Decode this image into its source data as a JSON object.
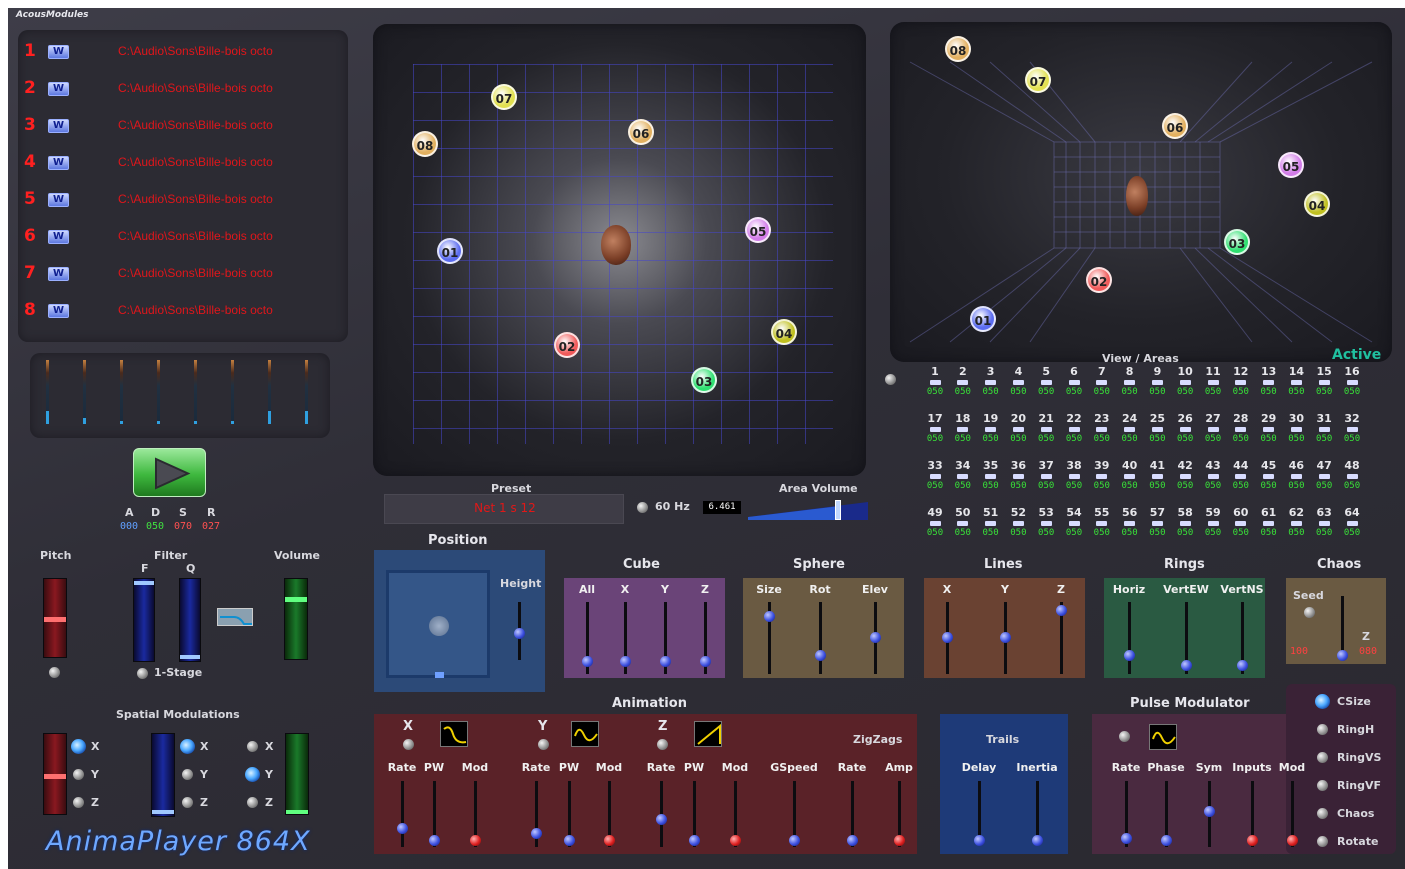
{
  "brand": "AcousModules",
  "app_title": "AnimaPlayer 864X",
  "tracks": [
    {
      "num": "1",
      "w": "W",
      "path": "C:\\Audio\\Sons\\Bille-bois octo"
    },
    {
      "num": "2",
      "w": "W",
      "path": "C:\\Audio\\Sons\\Bille-bois octo"
    },
    {
      "num": "3",
      "w": "W",
      "path": "C:\\Audio\\Sons\\Bille-bois octo"
    },
    {
      "num": "4",
      "w": "W",
      "path": "C:\\Audio\\Sons\\Bille-bois octo"
    },
    {
      "num": "5",
      "w": "W",
      "path": "C:\\Audio\\Sons\\Bille-bois octo"
    },
    {
      "num": "6",
      "w": "W",
      "path": "C:\\Audio\\Sons\\Bille-bois octo"
    },
    {
      "num": "7",
      "w": "W",
      "path": "C:\\Audio\\Sons\\Bille-bois octo"
    },
    {
      "num": "8",
      "w": "W",
      "path": "C:\\Audio\\Sons\\Bille-bois octo"
    }
  ],
  "meters": [
    0.2,
    0.1,
    0.05,
    0.05,
    0.05,
    0.05,
    0.2,
    0.2
  ],
  "adsr": {
    "labels": [
      "A",
      "D",
      "S",
      "R"
    ],
    "values": [
      "000",
      "050",
      "070",
      "027"
    ]
  },
  "left_controls": {
    "pitch": "Pitch",
    "filter": "Filter",
    "f": "F",
    "q": "Q",
    "volume": "Volume",
    "stage": "1-Stage"
  },
  "spatial": {
    "title": "Spatial Modulations",
    "x": "X",
    "y": "Y",
    "z": "Z"
  },
  "speakers_top": [
    "01",
    "02",
    "03",
    "04",
    "05",
    "06",
    "07",
    "08"
  ],
  "speakers_persp": [
    "01",
    "02",
    "03",
    "04",
    "05",
    "06",
    "07",
    "08"
  ],
  "preset": {
    "label": "Preset",
    "value": "Net 1 s 12",
    "hz": "60 Hz",
    "readout": "6.461",
    "area_volume": "Area Volume",
    "area_volume_level": 0.78
  },
  "view": {
    "title": "View / Areas",
    "status": "Active"
  },
  "areas": [
    {
      "n": "1",
      "v": "050"
    },
    {
      "n": "2",
      "v": "050"
    },
    {
      "n": "3",
      "v": "050"
    },
    {
      "n": "4",
      "v": "050"
    },
    {
      "n": "5",
      "v": "050"
    },
    {
      "n": "6",
      "v": "050"
    },
    {
      "n": "7",
      "v": "050"
    },
    {
      "n": "8",
      "v": "050"
    },
    {
      "n": "9",
      "v": "050"
    },
    {
      "n": "10",
      "v": "050"
    },
    {
      "n": "11",
      "v": "050"
    },
    {
      "n": "12",
      "v": "050"
    },
    {
      "n": "13",
      "v": "050"
    },
    {
      "n": "14",
      "v": "050"
    },
    {
      "n": "15",
      "v": "050"
    },
    {
      "n": "16",
      "v": "050"
    },
    {
      "n": "17",
      "v": "050"
    },
    {
      "n": "18",
      "v": "050"
    },
    {
      "n": "19",
      "v": "050"
    },
    {
      "n": "20",
      "v": "050"
    },
    {
      "n": "21",
      "v": "050"
    },
    {
      "n": "22",
      "v": "050"
    },
    {
      "n": "23",
      "v": "050"
    },
    {
      "n": "24",
      "v": "050"
    },
    {
      "n": "25",
      "v": "050"
    },
    {
      "n": "26",
      "v": "050"
    },
    {
      "n": "27",
      "v": "050"
    },
    {
      "n": "28",
      "v": "050"
    },
    {
      "n": "29",
      "v": "050"
    },
    {
      "n": "30",
      "v": "050"
    },
    {
      "n": "31",
      "v": "050"
    },
    {
      "n": "32",
      "v": "050"
    },
    {
      "n": "33",
      "v": "050"
    },
    {
      "n": "34",
      "v": "050"
    },
    {
      "n": "35",
      "v": "050"
    },
    {
      "n": "36",
      "v": "050"
    },
    {
      "n": "37",
      "v": "050"
    },
    {
      "n": "38",
      "v": "050"
    },
    {
      "n": "39",
      "v": "050"
    },
    {
      "n": "40",
      "v": "050"
    },
    {
      "n": "41",
      "v": "050"
    },
    {
      "n": "42",
      "v": "050"
    },
    {
      "n": "43",
      "v": "050"
    },
    {
      "n": "44",
      "v": "050"
    },
    {
      "n": "45",
      "v": "050"
    },
    {
      "n": "46",
      "v": "050"
    },
    {
      "n": "47",
      "v": "050"
    },
    {
      "n": "48",
      "v": "050"
    },
    {
      "n": "49",
      "v": "050"
    },
    {
      "n": "50",
      "v": "050"
    },
    {
      "n": "51",
      "v": "050"
    },
    {
      "n": "52",
      "v": "050"
    },
    {
      "n": "53",
      "v": "050"
    },
    {
      "n": "54",
      "v": "050"
    },
    {
      "n": "55",
      "v": "050"
    },
    {
      "n": "56",
      "v": "050"
    },
    {
      "n": "57",
      "v": "050"
    },
    {
      "n": "58",
      "v": "050"
    },
    {
      "n": "59",
      "v": "050"
    },
    {
      "n": "60",
      "v": "050"
    },
    {
      "n": "61",
      "v": "050"
    },
    {
      "n": "62",
      "v": "050"
    },
    {
      "n": "63",
      "v": "050"
    },
    {
      "n": "64",
      "v": "050"
    }
  ],
  "position": {
    "title": "Position",
    "height": "Height"
  },
  "cube": {
    "title": "Cube",
    "labels": [
      "All",
      "X",
      "Y",
      "Z"
    ]
  },
  "sphere": {
    "title": "Sphere",
    "labels": [
      "Size",
      "Rot",
      "Elev"
    ]
  },
  "lines": {
    "title": "Lines",
    "labels": [
      "X",
      "Y",
      "Z"
    ]
  },
  "rings": {
    "title": "Rings",
    "labels": [
      "Horiz",
      "VertEW",
      "VertNS"
    ]
  },
  "chaos": {
    "title": "Chaos",
    "seed": "Seed",
    "z": "Z",
    "v1": "100",
    "v2": "080"
  },
  "animation": {
    "title": "Animation",
    "x": "X",
    "y": "Y",
    "z": "Z",
    "zigzags": "ZigZags",
    "labels": [
      "Rate",
      "PW",
      "Mod",
      "Rate",
      "PW",
      "Mod",
      "Rate",
      "PW",
      "Mod",
      "GSpeed",
      "Rate",
      "Amp"
    ]
  },
  "trails": {
    "title": "Trails",
    "labels": [
      "Delay",
      "Inertia"
    ]
  },
  "pulse": {
    "title": "Pulse Modulator",
    "labels": [
      "Rate",
      "Phase",
      "Sym",
      "Inputs",
      "Mod"
    ]
  },
  "modes": [
    "CSize",
    "RingH",
    "RingVS",
    "RingVF",
    "Chaos",
    "Rotate"
  ],
  "colors": {
    "accent": "#3c50e0",
    "track_red": "#e0161b",
    "green_value": "#38e038",
    "active": "#20c0a0"
  }
}
